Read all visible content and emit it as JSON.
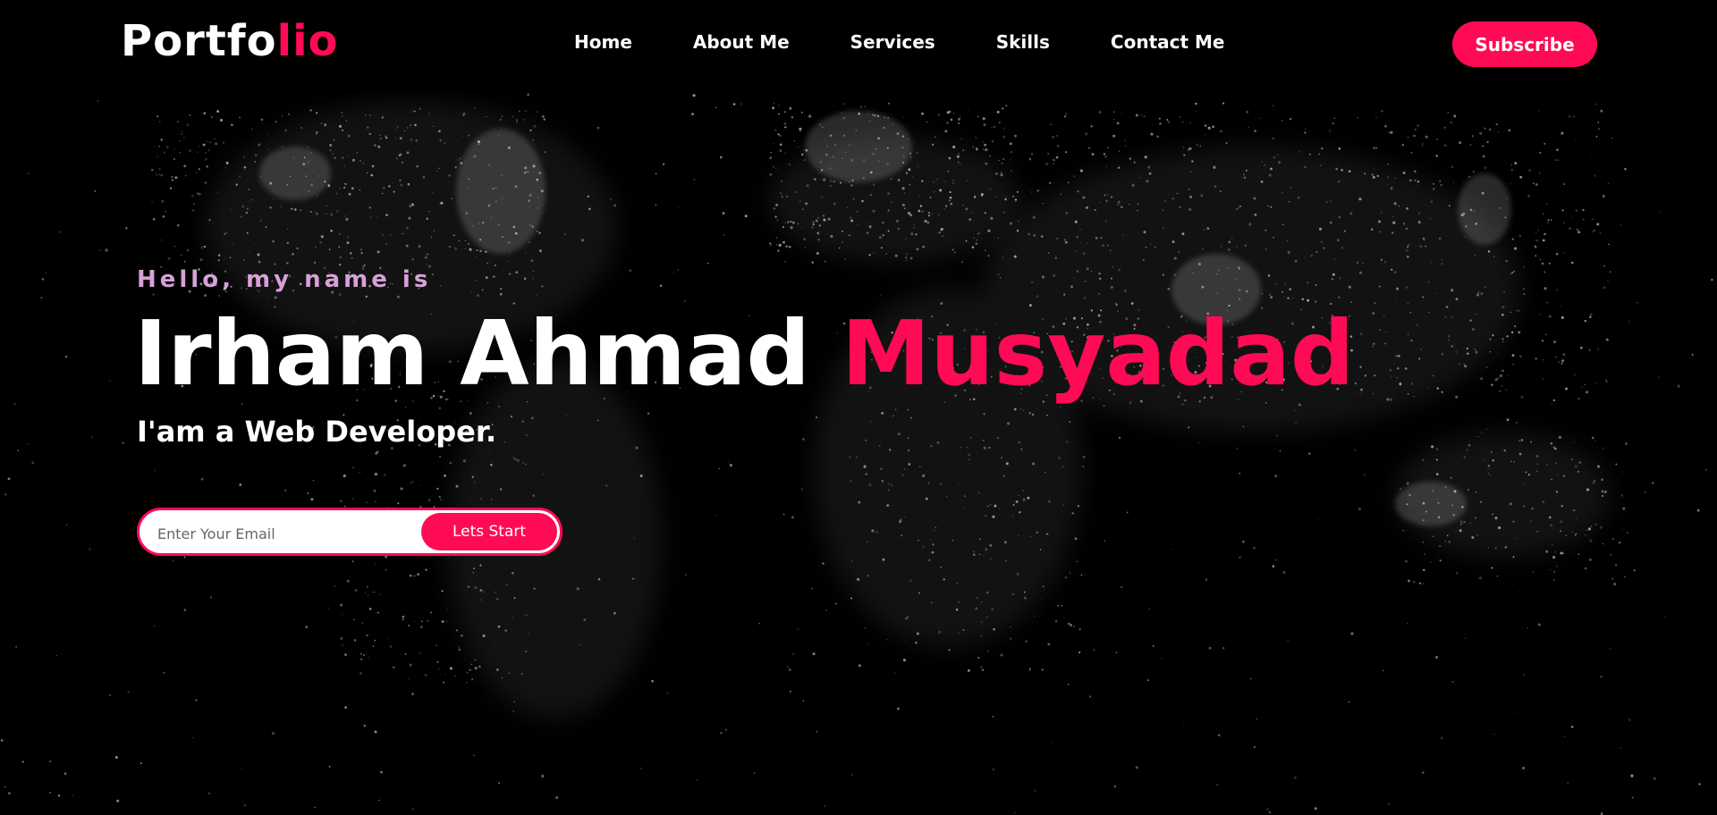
{
  "header": {
    "logo_main": "Portfo",
    "logo_accent": "lio",
    "nav": [
      {
        "label": "Home"
      },
      {
        "label": "About Me"
      },
      {
        "label": "Services"
      },
      {
        "label": "Skills"
      },
      {
        "label": "Contact Me"
      }
    ],
    "subscribe_label": "Subscribe"
  },
  "hero": {
    "greeting": "Hello, my name is",
    "first_name": "Irham Ahmad ",
    "last_name": "Musyadad",
    "role": "I'am a Web Developer.",
    "email_placeholder": "Enter Your Email",
    "cta_label": "Lets Start",
    "background": "world-map-night-lights"
  },
  "colors": {
    "accent": "#ff0a55",
    "greeting": "#d7a1d8",
    "background": "#000000",
    "text": "#ffffff"
  }
}
